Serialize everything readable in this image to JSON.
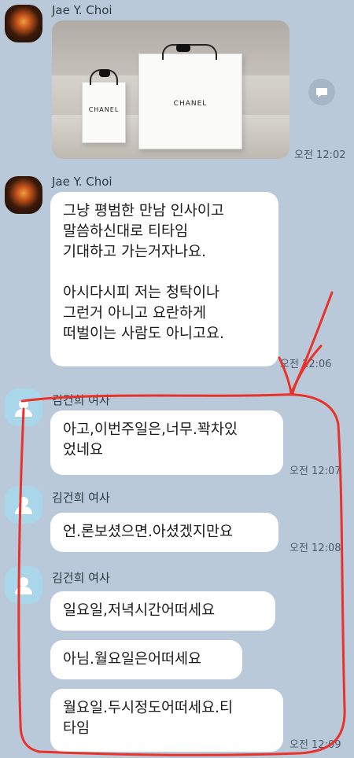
{
  "messages": [
    {
      "sender": "Jae Y. Choi",
      "type": "image",
      "image": {
        "bag_small_label": "CHANEL",
        "bag_large_label": "CHANEL"
      },
      "time": "오전 12:02"
    },
    {
      "sender": "Jae Y. Choi",
      "type": "text",
      "text": "그냥 평범한 만남 인사이고\n말씀하신대로  티타임\n기대하고 가는거자나요.\n\n 아시다시피 저는 청탁이나\n그런거 아니고 요란하게\n떠벌이는 사람도 아니고요.",
      "time": "오전 12:06"
    },
    {
      "sender": "김건희 여사",
      "type": "text",
      "text": "아고,이번주일은,너무.꽉차있\n었네요",
      "time": "오전 12:07"
    },
    {
      "sender": "김건희 여사",
      "type": "text",
      "text": "언.론보셨으면.아셨겠지만요",
      "time": "오전 12:08"
    },
    {
      "sender": "김건희 여사",
      "type": "text_group",
      "texts": [
        "일요일,저녁시간어떠세요",
        "아님.월요일은어떠세요",
        "월요일.두시정도어떠세요.티\n타임"
      ],
      "time": "오전 12:09"
    }
  ],
  "colors": {
    "background": "#b9c9d9",
    "bubble": "#ffffff",
    "annotation": "#e8322a"
  },
  "icons": {
    "share": "share-icon",
    "default_avatar": "person-icon"
  }
}
